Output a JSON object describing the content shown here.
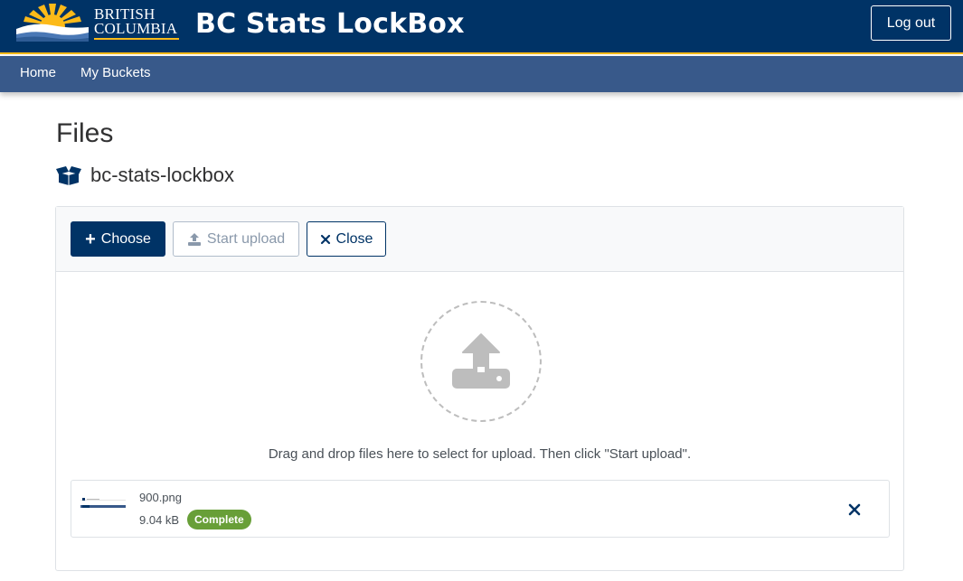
{
  "header": {
    "logo_line1": "BRITISH",
    "logo_line2": "COLUMBIA",
    "title": "BC Stats LockBox",
    "logout_label": "Log out",
    "colors": {
      "primary": "#003366",
      "accent": "#fcba19",
      "nav": "#38598a"
    }
  },
  "nav": {
    "items": [
      {
        "label": "Home"
      },
      {
        "label": "My Buckets"
      }
    ]
  },
  "page": {
    "title": "Files",
    "bucket_icon": "box-open-icon",
    "bucket_name": "bc-stats-lockbox"
  },
  "uploader": {
    "choose_label": "Choose",
    "choose_icon": "plus-icon",
    "start_label": "Start upload",
    "start_icon": "upload-icon",
    "close_label": "Close",
    "close_icon": "times-icon",
    "drop_icon": "upload-arrow-icon",
    "drop_hint": "Drag and drop files here to select for upload. Then click \"Start upload\".",
    "files": [
      {
        "name": "900.png",
        "size": "9.04 kB",
        "status": "Complete",
        "status_color": "#689f38",
        "remove_icon": "times-icon"
      }
    ]
  }
}
